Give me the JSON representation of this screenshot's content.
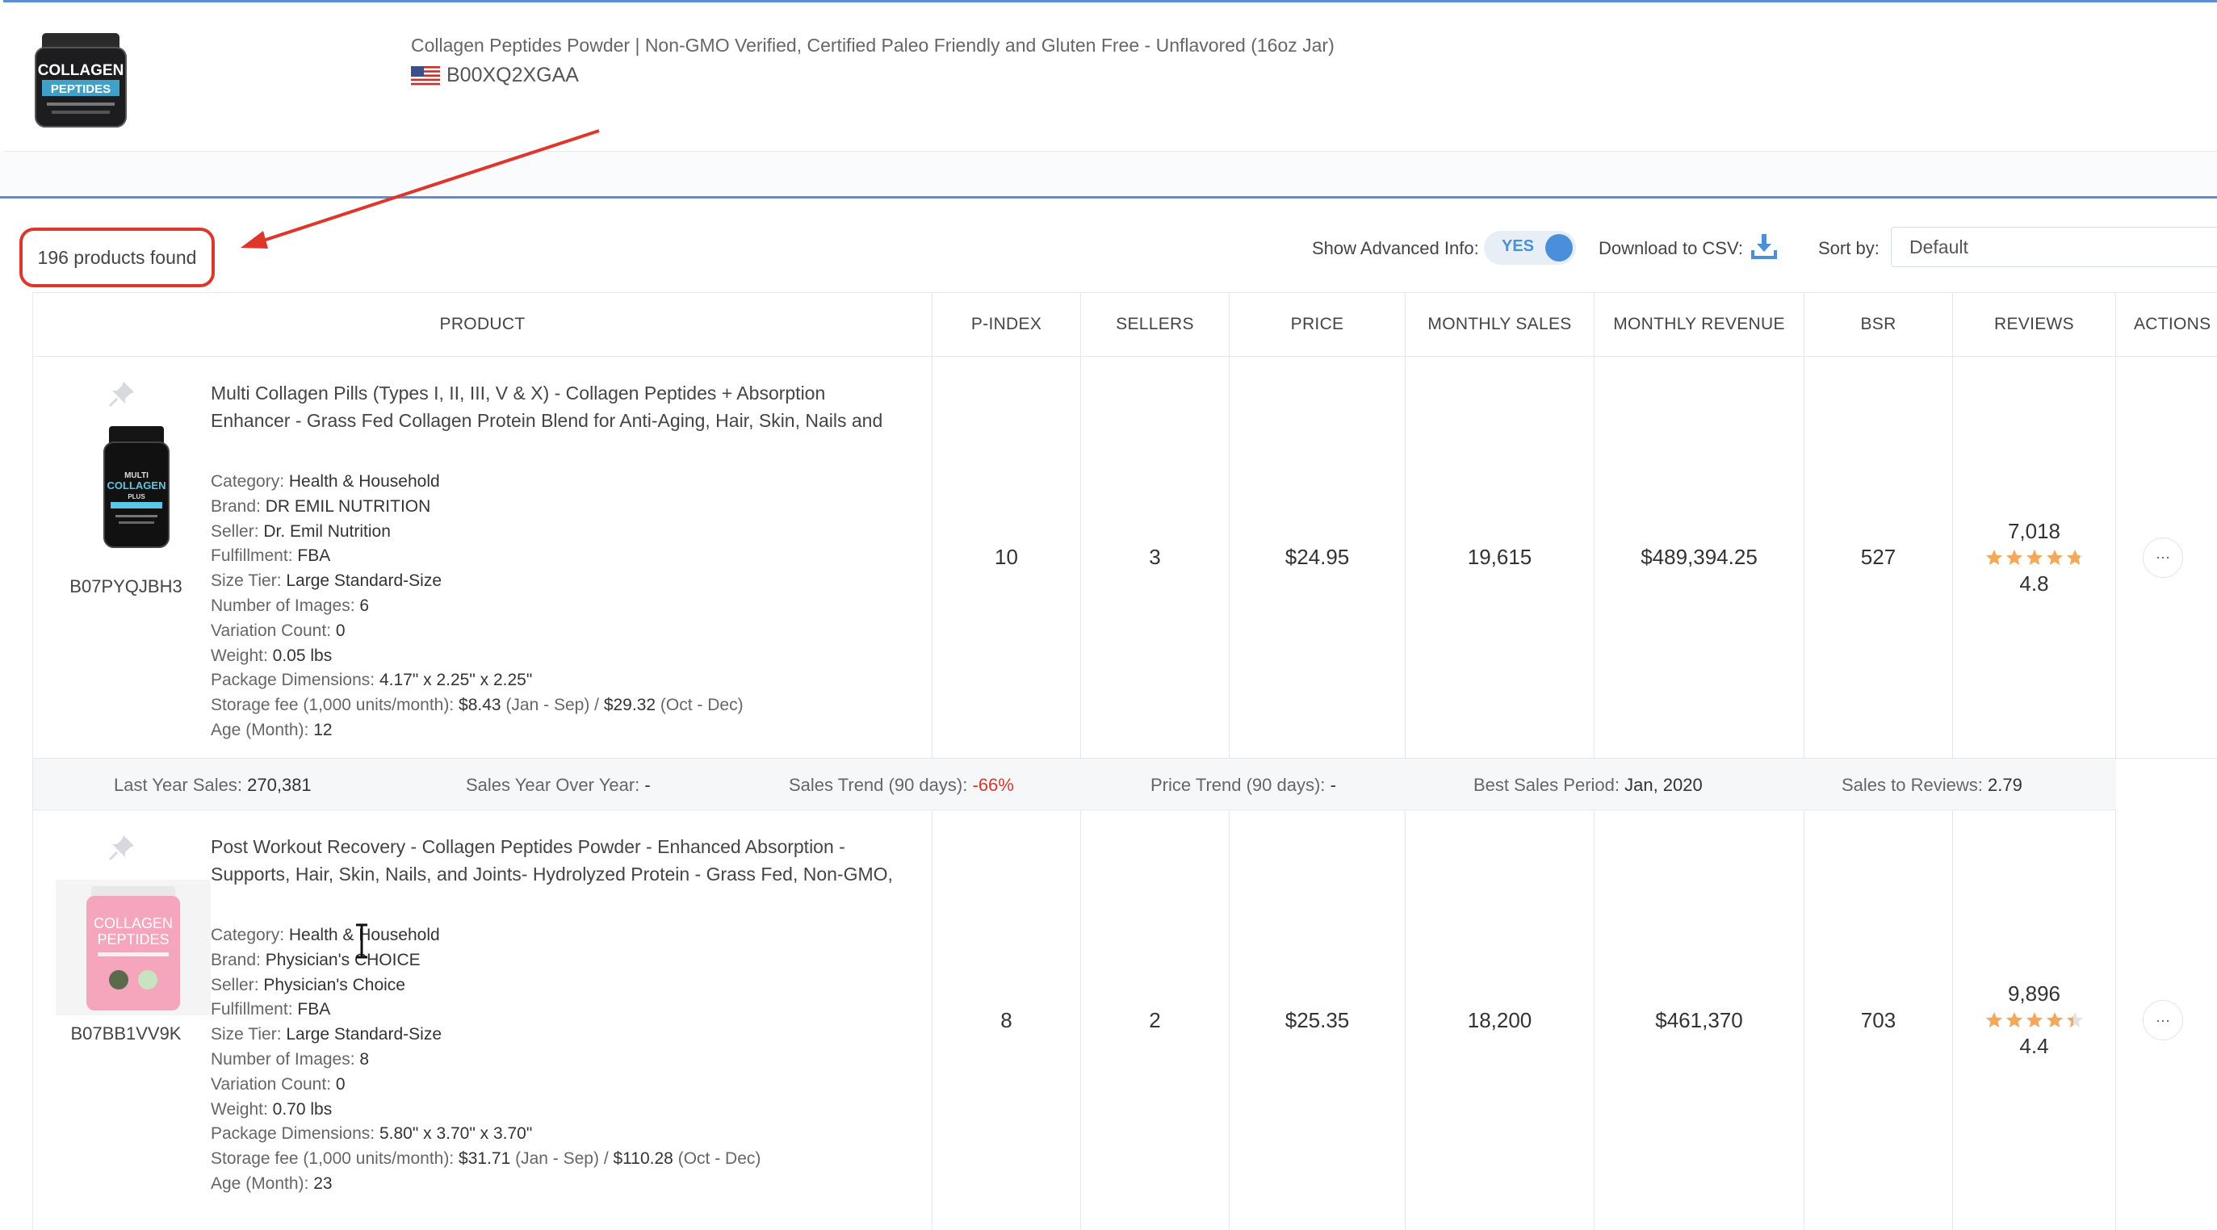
{
  "header": {
    "title": "Collagen Peptides Powder | Non-GMO Verified, Certified Paleo Friendly and Gluten Free - Unflavored (16oz Jar)",
    "asin": "B00XQ2XGAA",
    "thumb_text_1": "COLLAGEN",
    "thumb_text_2": "PEPTIDES"
  },
  "results": {
    "count_text": "196 products found"
  },
  "toolbar": {
    "show_advanced_label": "Show Advanced Info:",
    "show_advanced_value": "YES",
    "download_label": "Download to CSV:",
    "sort_label": "Sort by:",
    "sort_value": "Default"
  },
  "columns": [
    "PRODUCT",
    "P-INDEX",
    "SELLERS",
    "PRICE",
    "MONTHLY SALES",
    "MONTHLY REVENUE",
    "BSR",
    "REVIEWS",
    "ACTIONS"
  ],
  "products": [
    {
      "title_line1": "Multi Collagen Pills (Types I, II, III, V & X) - Collagen Peptides + Absorption",
      "title_line2": "Enhancer - Grass Fed Collagen Protein Blend for Anti-Aging, Hair, Skin, Nails and",
      "asin": "B07PYQJBH3",
      "thumb_text_1": "MULTI",
      "thumb_text_2": "COLLAGEN",
      "thumb_text_3": "PLUS",
      "details": {
        "category_k": "Category:",
        "category_v": "Health & Household",
        "brand_k": "Brand:",
        "brand_v": "DR EMIL NUTRITION",
        "seller_k": "Seller:",
        "seller_v": "Dr. Emil Nutrition",
        "fulfillment_k": "Fulfillment:",
        "fulfillment_v": "FBA",
        "size_k": "Size Tier:",
        "size_v": "Large Standard-Size",
        "images_k": "Number of Images:",
        "images_v": "6",
        "variation_k": "Variation Count:",
        "variation_v": "0",
        "weight_k": "Weight:",
        "weight_v": "0.05 lbs",
        "dims_k": "Package Dimensions:",
        "dims_v": "4.17\" x 2.25\" x 2.25\"",
        "storage_k": "Storage fee (1,000 units/month):",
        "storage_v1": "$8.43",
        "storage_p1": "(Jan - Sep) /",
        "storage_v2": "$29.32",
        "storage_p2": "(Oct - Dec)",
        "age_k": "Age (Month):",
        "age_v": "12"
      },
      "p_index": "10",
      "sellers": "3",
      "price": "$24.95",
      "monthly_sales": "19,615",
      "monthly_revenue": "$489,394.25",
      "bsr": "527",
      "reviews": "7,018",
      "rating": "4.8",
      "rating_value": 4.8,
      "actions": "···",
      "stats": {
        "last_year_k": "Last Year Sales:",
        "last_year_v": "270,381",
        "yoy_k": "Sales Year Over Year:",
        "yoy_v": "-",
        "trend_k": "Sales Trend (90 days):",
        "trend_v": "-66%",
        "price_trend_k": "Price Trend (90 days):",
        "price_trend_v": "-",
        "best_period_k": "Best Sales Period:",
        "best_period_v": "Jan, 2020",
        "s2r_k": "Sales to Reviews:",
        "s2r_v": "2.79"
      }
    },
    {
      "title_line1": "Post Workout Recovery - Collagen Peptides Powder - Enhanced Absorption -",
      "title_line2": "Supports, Hair, Skin, Nails, and Joints- Hydrolyzed Protein - Grass Fed, Non-GMO,",
      "asin": "B07BB1VV9K",
      "thumb_text_1": "COLLAGEN",
      "thumb_text_2": "PEPTIDES",
      "details": {
        "category_k": "Category:",
        "category_v": "Health & Household",
        "brand_k": "Brand:",
        "brand_v": "Physician's CHOICE",
        "seller_k": "Seller:",
        "seller_v": "Physician's Choice",
        "fulfillment_k": "Fulfillment:",
        "fulfillment_v": "FBA",
        "size_k": "Size Tier:",
        "size_v": "Large Standard-Size",
        "images_k": "Number of Images:",
        "images_v": "8",
        "variation_k": "Variation Count:",
        "variation_v": "0",
        "weight_k": "Weight:",
        "weight_v": "0.70 lbs",
        "dims_k": "Package Dimensions:",
        "dims_v": "5.80\" x 3.70\" x 3.70\"",
        "storage_k": "Storage fee (1,000 units/month):",
        "storage_v1": "$31.71",
        "storage_p1": "(Jan - Sep) /",
        "storage_v2": "$110.28",
        "storage_p2": "(Oct - Dec)",
        "age_k": "Age (Month):",
        "age_v": "23"
      },
      "p_index": "8",
      "sellers": "2",
      "price": "$25.35",
      "monthly_sales": "18,200",
      "monthly_revenue": "$461,370",
      "bsr": "703",
      "reviews": "9,896",
      "rating": "4.4",
      "rating_value": 4.4,
      "actions": "···"
    }
  ],
  "colors": {
    "accent_blue": "#4a8fd9",
    "annotation_red": "#e0352b",
    "star": "#f3a85b",
    "negative": "#e0352b"
  }
}
